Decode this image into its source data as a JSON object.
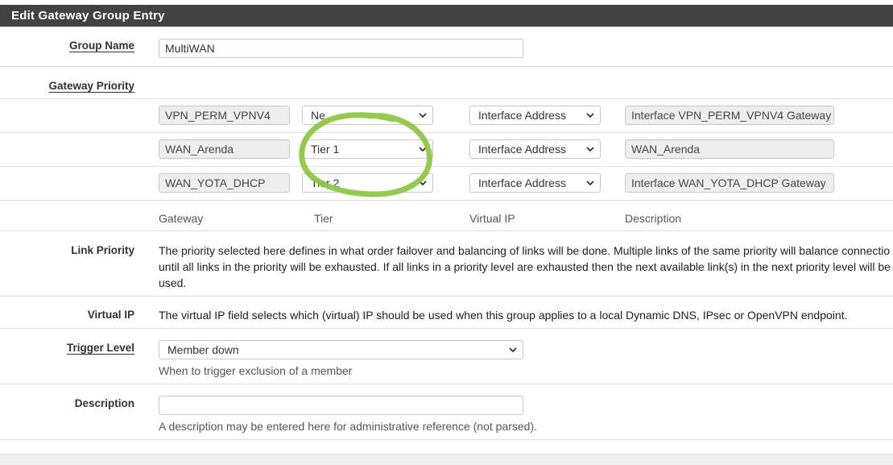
{
  "panel": {
    "title": "Edit Gateway Group Entry"
  },
  "group_name": {
    "label": "Group Name",
    "value": "MultiWAN"
  },
  "gateway_priority": {
    "label": "Gateway Priority",
    "rows": [
      {
        "gateway": "VPN_PERM_VPNV4",
        "tier": "Ne",
        "virtual_ip": "Interface Address",
        "description": "Interface VPN_PERM_VPNV4 Gateway"
      },
      {
        "gateway": "WAN_Arenda",
        "tier": "Tier 1",
        "virtual_ip": "Interface Address",
        "description": "WAN_Arenda"
      },
      {
        "gateway": "WAN_YOTA_DHCP",
        "tier": "Tier 2",
        "virtual_ip": "Interface Address",
        "description": "Interface WAN_YOTA_DHCP Gateway"
      }
    ],
    "columns": {
      "gateway": "Gateway",
      "tier": "Tier",
      "virtual_ip": "Virtual IP",
      "description": "Description"
    }
  },
  "link_priority": {
    "label": "Link Priority",
    "line1": "The priority selected here defines in what order failover and balancing of links will be done. Multiple links of the same priority will balance connectio",
    "line2": "until all links in the priority will be exhausted. If all links in a priority level are exhausted then the next available link(s) in the next priority level will be",
    "line3": "used."
  },
  "virtual_ip": {
    "label": "Virtual IP",
    "text": "The virtual IP field selects which (virtual) IP should be used when this group applies to a local Dynamic DNS, IPsec or OpenVPN endpoint."
  },
  "trigger_level": {
    "label": "Trigger Level",
    "value": "Member down",
    "help": "When to trigger exclusion of a member"
  },
  "description": {
    "label": "Description",
    "value": "",
    "help": "A description may be entered here for administrative reference (not parsed)."
  },
  "annotation": {
    "color": "#8dc63f"
  },
  "icons": {
    "select_arrow": "chevron-down-icon"
  }
}
